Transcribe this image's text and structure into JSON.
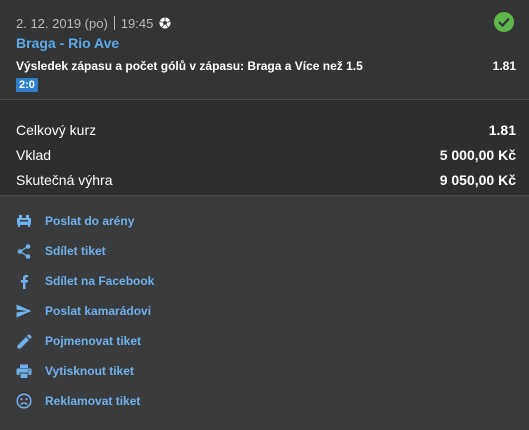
{
  "bet": {
    "date": "2. 12. 2019 (po)",
    "time": "19:45",
    "sport_icon": "football-icon",
    "status_icon": "check-circle-icon",
    "status_color": "#5fb64a",
    "match": "Braga - Rio Ave",
    "selection": "Výsledek zápasu a počet gólů v zápasu: Braga a Více než 1.5",
    "odds": "1.81",
    "score": "2:0"
  },
  "summary": {
    "total_odds_label": "Celkový kurz",
    "total_odds_value": "1.81",
    "stake_label": "Vklad",
    "stake_value": "5 000,00 Kč",
    "win_label": "Skutečná výhra",
    "win_value": "9 050,00 Kč"
  },
  "actions": [
    {
      "label": "Poslat do arény",
      "icon": "arena-icon"
    },
    {
      "label": "Sdílet tiket",
      "icon": "share-icon"
    },
    {
      "label": "Sdílet na Facebook",
      "icon": "facebook-icon"
    },
    {
      "label": "Poslat kamarádovi",
      "icon": "send-icon"
    },
    {
      "label": "Pojmenovat tiket",
      "icon": "pencil-icon"
    },
    {
      "label": "Vytisknout tiket",
      "icon": "printer-icon"
    },
    {
      "label": "Reklamovat tiket",
      "icon": "sad-face-icon"
    }
  ],
  "colors": {
    "link": "#6fb1ec",
    "match": "#5ca9ea",
    "badge": "#2d7fcc"
  }
}
